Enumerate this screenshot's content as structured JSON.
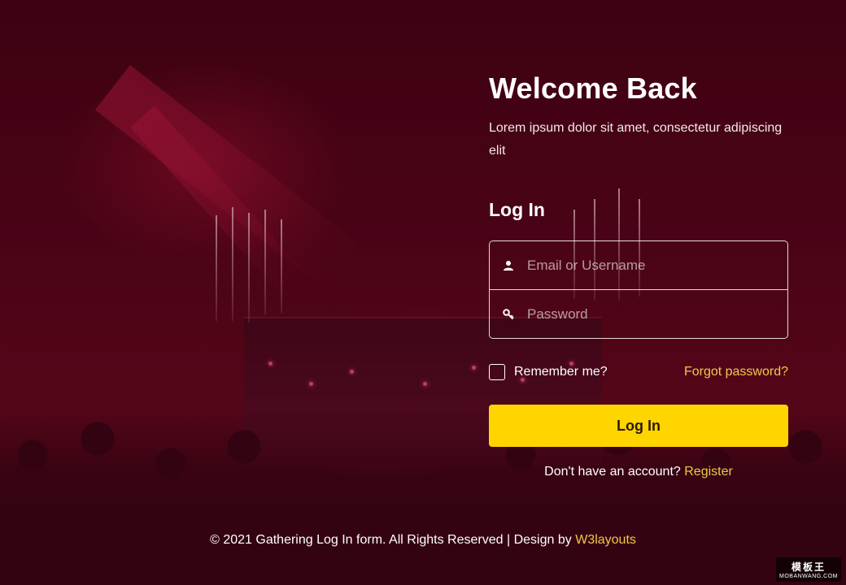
{
  "hero": {
    "title": "Welcome Back",
    "subtitle": "Lorem ipsum dolor sit amet, consectetur adipiscing elit"
  },
  "form": {
    "heading": "Log In",
    "username_placeholder": "Email or Username",
    "password_placeholder": "Password",
    "remember_label": "Remember me?",
    "forgot_link": "Forgot password?",
    "submit_label": "Log In",
    "signup_text": "Don't have an account?",
    "signup_link": "Register"
  },
  "footer": {
    "text": "© 2021 Gathering Log In form. All Rights Reserved | Design by",
    "credit_link": "W3layouts"
  },
  "watermark": {
    "title": "模板王",
    "site": "MOBANWANG.COM"
  },
  "icons": {
    "username": "user-icon",
    "password": "key-icon"
  },
  "colors": {
    "accent": "#ffd500",
    "link": "#f2c84b",
    "overlay": "#4a0715"
  }
}
